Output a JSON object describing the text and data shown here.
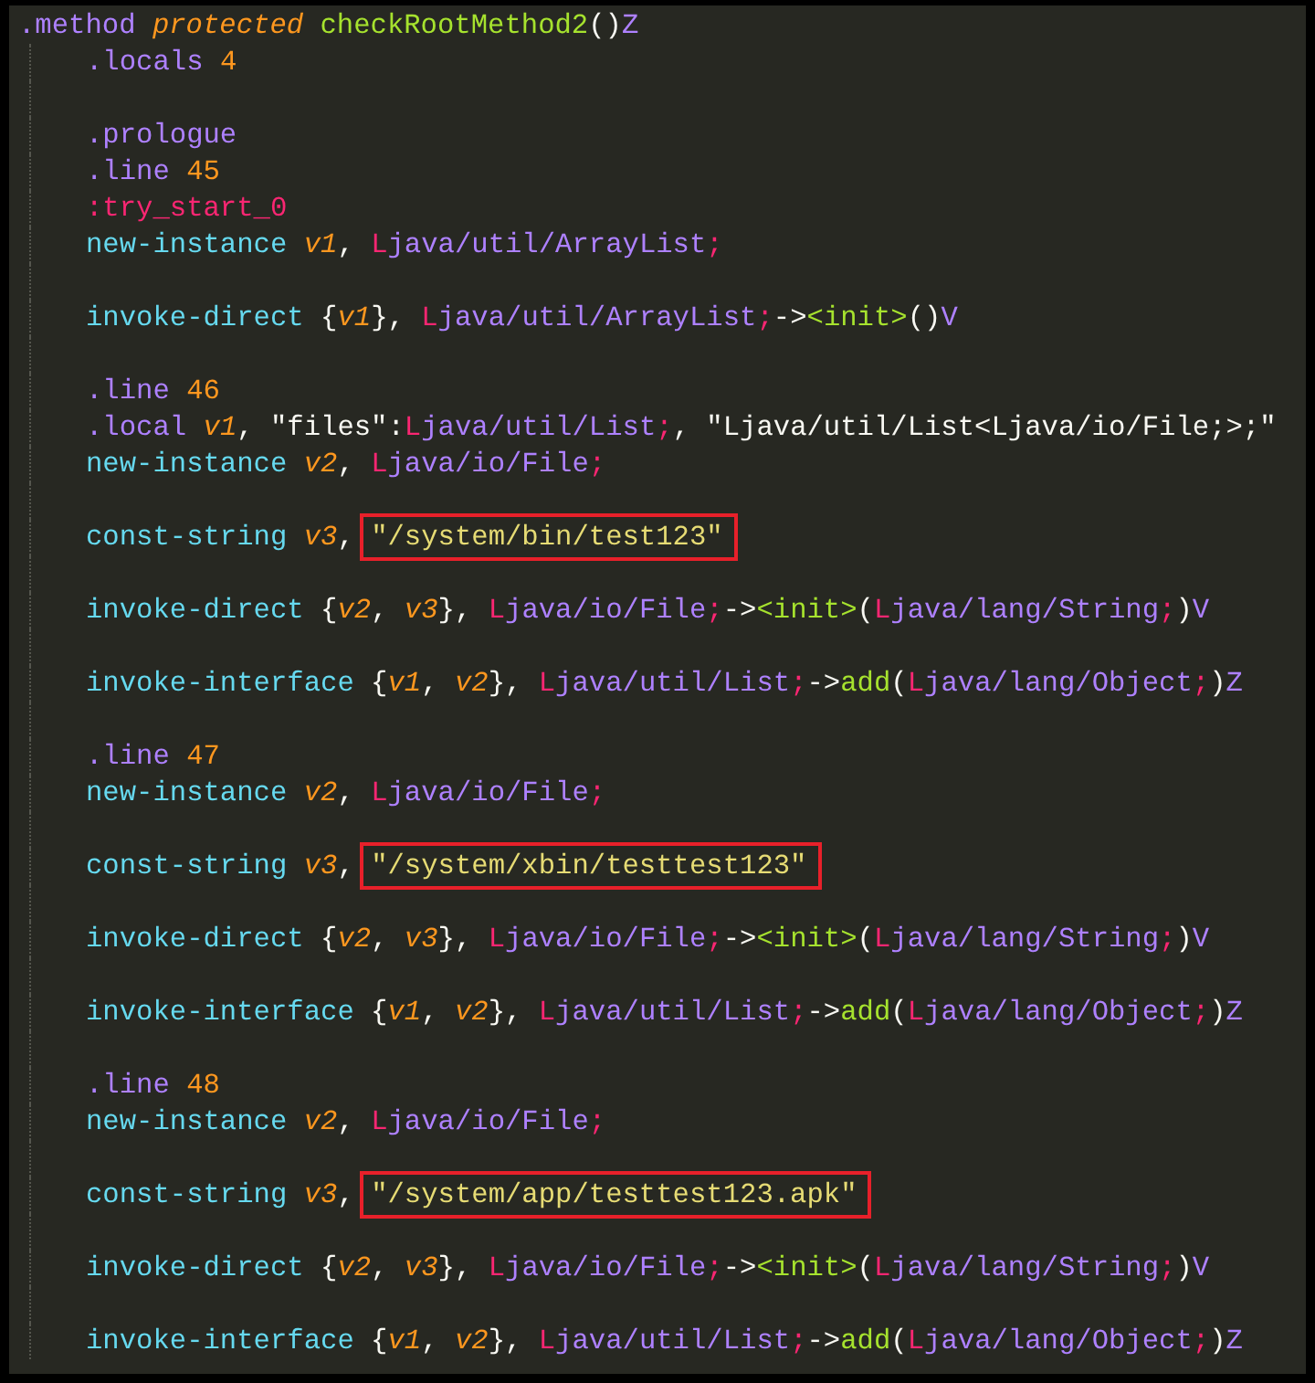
{
  "lines": [
    {
      "kind": "code",
      "indented": false,
      "tokens": [
        {
          "text": ".method ",
          "kind": "directive"
        },
        {
          "text": "protected ",
          "kind": "modifier"
        },
        {
          "text": "checkRootMethod2",
          "kind": "name"
        },
        {
          "text": "()",
          "kind": "punct"
        },
        {
          "text": "Z",
          "kind": "type"
        }
      ]
    },
    {
      "kind": "code",
      "indented": true,
      "tokens": [
        {
          "text": ".locals ",
          "kind": "directive"
        },
        {
          "text": "4",
          "kind": "number"
        }
      ]
    },
    {
      "kind": "blank"
    },
    {
      "kind": "code",
      "indented": true,
      "tokens": [
        {
          "text": ".prologue",
          "kind": "directive"
        }
      ]
    },
    {
      "kind": "code",
      "indented": true,
      "tokens": [
        {
          "text": ".line ",
          "kind": "directive"
        },
        {
          "text": "45",
          "kind": "number"
        }
      ]
    },
    {
      "kind": "code",
      "indented": true,
      "tokens": [
        {
          "text": ":try_start_0",
          "kind": "label"
        }
      ]
    },
    {
      "kind": "code",
      "indented": true,
      "tokens": [
        {
          "text": "new-instance ",
          "kind": "opcode"
        },
        {
          "text": "v1",
          "kind": "register"
        },
        {
          "text": ", ",
          "kind": "punct"
        },
        {
          "text": "L",
          "kind": "marker"
        },
        {
          "text": "java/util/ArrayList",
          "kind": "type"
        },
        {
          "text": ";",
          "kind": "marker"
        }
      ]
    },
    {
      "kind": "blank"
    },
    {
      "kind": "code",
      "indented": true,
      "tokens": [
        {
          "text": "invoke-direct",
          "kind": "opcode"
        },
        {
          "text": " {",
          "kind": "punct"
        },
        {
          "text": "v1",
          "kind": "register"
        },
        {
          "text": "}, ",
          "kind": "punct"
        },
        {
          "text": "L",
          "kind": "marker"
        },
        {
          "text": "java/util/ArrayList",
          "kind": "type"
        },
        {
          "text": ";",
          "kind": "marker"
        },
        {
          "text": "->",
          "kind": "punct"
        },
        {
          "text": "<init>",
          "kind": "name"
        },
        {
          "text": "()",
          "kind": "punct"
        },
        {
          "text": "V",
          "kind": "type"
        }
      ]
    },
    {
      "kind": "blank"
    },
    {
      "kind": "code",
      "indented": true,
      "tokens": [
        {
          "text": ".line ",
          "kind": "directive"
        },
        {
          "text": "46",
          "kind": "number"
        }
      ]
    },
    {
      "kind": "code",
      "indented": true,
      "tokens": [
        {
          "text": ".local ",
          "kind": "directive"
        },
        {
          "text": "v1",
          "kind": "register"
        },
        {
          "text": ", \"files\":",
          "kind": "punct"
        },
        {
          "text": "L",
          "kind": "marker"
        },
        {
          "text": "java/util/List",
          "kind": "type"
        },
        {
          "text": ";",
          "kind": "marker"
        },
        {
          "text": ", \"Ljava/util/List<Ljava/io/File;>;\"",
          "kind": "punct"
        }
      ]
    },
    {
      "kind": "code",
      "indented": true,
      "tokens": [
        {
          "text": "new-instance ",
          "kind": "opcode"
        },
        {
          "text": "v2",
          "kind": "register"
        },
        {
          "text": ", ",
          "kind": "punct"
        },
        {
          "text": "L",
          "kind": "marker"
        },
        {
          "text": "java/io/File",
          "kind": "type"
        },
        {
          "text": ";",
          "kind": "marker"
        }
      ]
    },
    {
      "kind": "blank"
    },
    {
      "kind": "code",
      "indented": true,
      "tokens": [
        {
          "text": "const-string ",
          "kind": "opcode"
        },
        {
          "text": "v3",
          "kind": "register"
        },
        {
          "text": ", ",
          "kind": "punct"
        },
        {
          "text": "\"/system/bin/test123\"",
          "kind": "highlighted_string"
        }
      ]
    },
    {
      "kind": "blank"
    },
    {
      "kind": "code",
      "indented": true,
      "tokens": [
        {
          "text": "invoke-direct",
          "kind": "opcode"
        },
        {
          "text": " {",
          "kind": "punct"
        },
        {
          "text": "v2",
          "kind": "register"
        },
        {
          "text": ", ",
          "kind": "punct"
        },
        {
          "text": "v3",
          "kind": "register"
        },
        {
          "text": "}, ",
          "kind": "punct"
        },
        {
          "text": "L",
          "kind": "marker"
        },
        {
          "text": "java/io/File",
          "kind": "type"
        },
        {
          "text": ";",
          "kind": "marker"
        },
        {
          "text": "->",
          "kind": "punct"
        },
        {
          "text": "<init>",
          "kind": "name"
        },
        {
          "text": "(",
          "kind": "punct"
        },
        {
          "text": "L",
          "kind": "marker"
        },
        {
          "text": "java/lang/String",
          "kind": "type"
        },
        {
          "text": ";",
          "kind": "marker"
        },
        {
          "text": ")",
          "kind": "punct"
        },
        {
          "text": "V",
          "kind": "type"
        }
      ]
    },
    {
      "kind": "blank"
    },
    {
      "kind": "code",
      "indented": true,
      "tokens": [
        {
          "text": "invoke-interface",
          "kind": "opcode"
        },
        {
          "text": " {",
          "kind": "punct"
        },
        {
          "text": "v1",
          "kind": "register"
        },
        {
          "text": ", ",
          "kind": "punct"
        },
        {
          "text": "v2",
          "kind": "register"
        },
        {
          "text": "}, ",
          "kind": "punct"
        },
        {
          "text": "L",
          "kind": "marker"
        },
        {
          "text": "java/util/List",
          "kind": "type"
        },
        {
          "text": ";",
          "kind": "marker"
        },
        {
          "text": "->",
          "kind": "punct"
        },
        {
          "text": "add",
          "kind": "name"
        },
        {
          "text": "(",
          "kind": "punct"
        },
        {
          "text": "L",
          "kind": "marker"
        },
        {
          "text": "java/lang/Object",
          "kind": "type"
        },
        {
          "text": ";",
          "kind": "marker"
        },
        {
          "text": ")",
          "kind": "punct"
        },
        {
          "text": "Z",
          "kind": "type"
        }
      ]
    },
    {
      "kind": "blank"
    },
    {
      "kind": "code",
      "indented": true,
      "tokens": [
        {
          "text": ".line ",
          "kind": "directive"
        },
        {
          "text": "47",
          "kind": "number"
        }
      ]
    },
    {
      "kind": "code",
      "indented": true,
      "tokens": [
        {
          "text": "new-instance ",
          "kind": "opcode"
        },
        {
          "text": "v2",
          "kind": "register"
        },
        {
          "text": ", ",
          "kind": "punct"
        },
        {
          "text": "L",
          "kind": "marker"
        },
        {
          "text": "java/io/File",
          "kind": "type"
        },
        {
          "text": ";",
          "kind": "marker"
        }
      ]
    },
    {
      "kind": "blank"
    },
    {
      "kind": "code",
      "indented": true,
      "tokens": [
        {
          "text": "const-string ",
          "kind": "opcode"
        },
        {
          "text": "v3",
          "kind": "register"
        },
        {
          "text": ", ",
          "kind": "punct"
        },
        {
          "text": "\"/system/xbin/testtest123\"",
          "kind": "highlighted_string"
        }
      ]
    },
    {
      "kind": "blank"
    },
    {
      "kind": "code",
      "indented": true,
      "tokens": [
        {
          "text": "invoke-direct",
          "kind": "opcode"
        },
        {
          "text": " {",
          "kind": "punct"
        },
        {
          "text": "v2",
          "kind": "register"
        },
        {
          "text": ", ",
          "kind": "punct"
        },
        {
          "text": "v3",
          "kind": "register"
        },
        {
          "text": "}, ",
          "kind": "punct"
        },
        {
          "text": "L",
          "kind": "marker"
        },
        {
          "text": "java/io/File",
          "kind": "type"
        },
        {
          "text": ";",
          "kind": "marker"
        },
        {
          "text": "->",
          "kind": "punct"
        },
        {
          "text": "<init>",
          "kind": "name"
        },
        {
          "text": "(",
          "kind": "punct"
        },
        {
          "text": "L",
          "kind": "marker"
        },
        {
          "text": "java/lang/String",
          "kind": "type"
        },
        {
          "text": ";",
          "kind": "marker"
        },
        {
          "text": ")",
          "kind": "punct"
        },
        {
          "text": "V",
          "kind": "type"
        }
      ]
    },
    {
      "kind": "blank"
    },
    {
      "kind": "code",
      "indented": true,
      "tokens": [
        {
          "text": "invoke-interface",
          "kind": "opcode"
        },
        {
          "text": " {",
          "kind": "punct"
        },
        {
          "text": "v1",
          "kind": "register"
        },
        {
          "text": ", ",
          "kind": "punct"
        },
        {
          "text": "v2",
          "kind": "register"
        },
        {
          "text": "}, ",
          "kind": "punct"
        },
        {
          "text": "L",
          "kind": "marker"
        },
        {
          "text": "java/util/List",
          "kind": "type"
        },
        {
          "text": ";",
          "kind": "marker"
        },
        {
          "text": "->",
          "kind": "punct"
        },
        {
          "text": "add",
          "kind": "name"
        },
        {
          "text": "(",
          "kind": "punct"
        },
        {
          "text": "L",
          "kind": "marker"
        },
        {
          "text": "java/lang/Object",
          "kind": "type"
        },
        {
          "text": ";",
          "kind": "marker"
        },
        {
          "text": ")",
          "kind": "punct"
        },
        {
          "text": "Z",
          "kind": "type"
        }
      ]
    },
    {
      "kind": "blank"
    },
    {
      "kind": "code",
      "indented": true,
      "tokens": [
        {
          "text": ".line ",
          "kind": "directive"
        },
        {
          "text": "48",
          "kind": "number"
        }
      ]
    },
    {
      "kind": "code",
      "indented": true,
      "tokens": [
        {
          "text": "new-instance ",
          "kind": "opcode"
        },
        {
          "text": "v2",
          "kind": "register"
        },
        {
          "text": ", ",
          "kind": "punct"
        },
        {
          "text": "L",
          "kind": "marker"
        },
        {
          "text": "java/io/File",
          "kind": "type"
        },
        {
          "text": ";",
          "kind": "marker"
        }
      ]
    },
    {
      "kind": "blank"
    },
    {
      "kind": "code",
      "indented": true,
      "tokens": [
        {
          "text": "const-string ",
          "kind": "opcode"
        },
        {
          "text": "v3",
          "kind": "register"
        },
        {
          "text": ", ",
          "kind": "punct"
        },
        {
          "text": "\"/system/app/testtest123.apk\"",
          "kind": "highlighted_string"
        }
      ]
    },
    {
      "kind": "blank"
    },
    {
      "kind": "code",
      "indented": true,
      "tokens": [
        {
          "text": "invoke-direct",
          "kind": "opcode"
        },
        {
          "text": " {",
          "kind": "punct"
        },
        {
          "text": "v2",
          "kind": "register"
        },
        {
          "text": ", ",
          "kind": "punct"
        },
        {
          "text": "v3",
          "kind": "register"
        },
        {
          "text": "}, ",
          "kind": "punct"
        },
        {
          "text": "L",
          "kind": "marker"
        },
        {
          "text": "java/io/File",
          "kind": "type"
        },
        {
          "text": ";",
          "kind": "marker"
        },
        {
          "text": "->",
          "kind": "punct"
        },
        {
          "text": "<init>",
          "kind": "name"
        },
        {
          "text": "(",
          "kind": "punct"
        },
        {
          "text": "L",
          "kind": "marker"
        },
        {
          "text": "java/lang/String",
          "kind": "type"
        },
        {
          "text": ";",
          "kind": "marker"
        },
        {
          "text": ")",
          "kind": "punct"
        },
        {
          "text": "V",
          "kind": "type"
        }
      ]
    },
    {
      "kind": "blank"
    },
    {
      "kind": "code",
      "indented": true,
      "tokens": [
        {
          "text": "invoke-interface",
          "kind": "opcode"
        },
        {
          "text": " {",
          "kind": "punct"
        },
        {
          "text": "v1",
          "kind": "register"
        },
        {
          "text": ", ",
          "kind": "punct"
        },
        {
          "text": "v2",
          "kind": "register"
        },
        {
          "text": "}, ",
          "kind": "punct"
        },
        {
          "text": "L",
          "kind": "marker"
        },
        {
          "text": "java/util/List",
          "kind": "type"
        },
        {
          "text": ";",
          "kind": "marker"
        },
        {
          "text": "->",
          "kind": "punct"
        },
        {
          "text": "add",
          "kind": "name"
        },
        {
          "text": "(",
          "kind": "punct"
        },
        {
          "text": "L",
          "kind": "marker"
        },
        {
          "text": "java/lang/Object",
          "kind": "type"
        },
        {
          "text": ";",
          "kind": "marker"
        },
        {
          "text": ")",
          "kind": "punct"
        },
        {
          "text": "Z",
          "kind": "type"
        }
      ]
    }
  ]
}
